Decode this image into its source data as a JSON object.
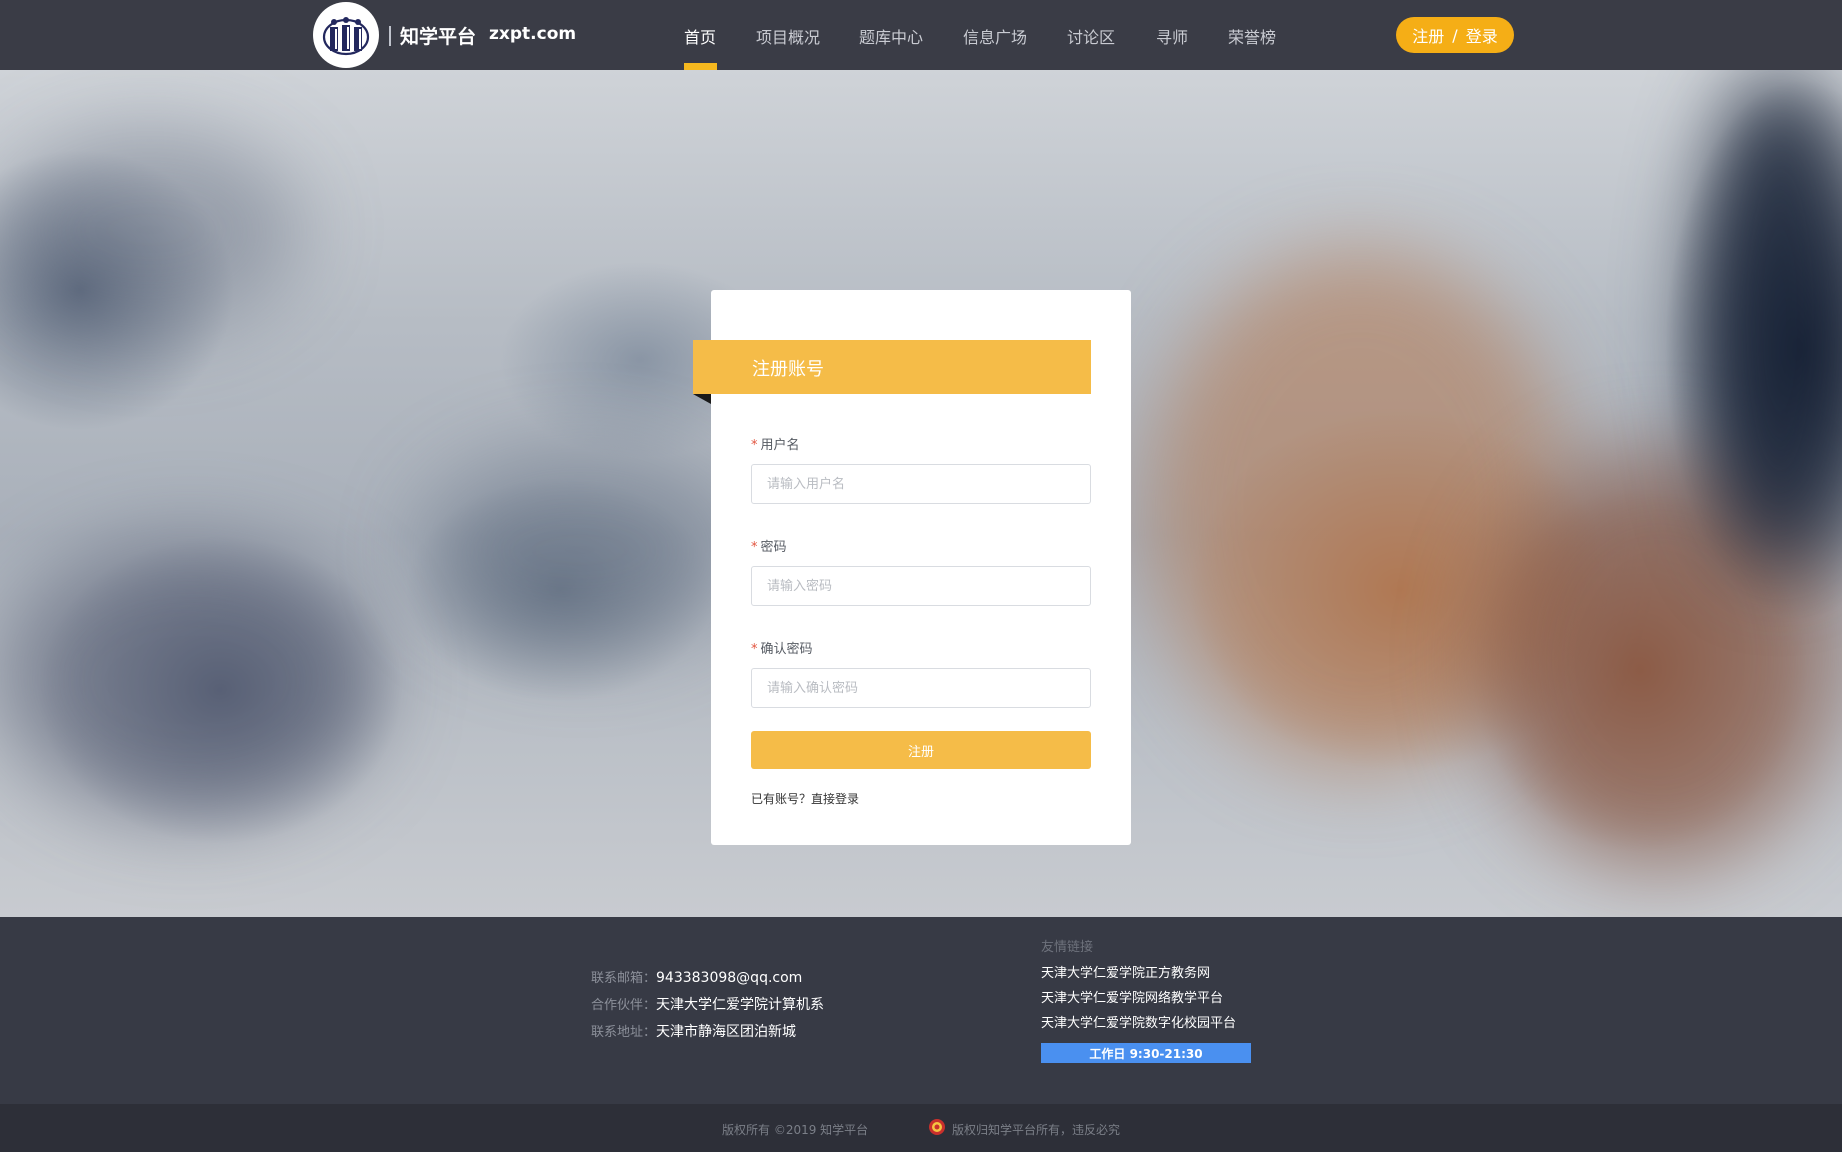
{
  "header": {
    "brand_name": "知学平台",
    "brand_domain": "zxpt.com",
    "nav": [
      {
        "label": "首页",
        "active": true
      },
      {
        "label": "项目概况",
        "active": false
      },
      {
        "label": "题库中心",
        "active": false
      },
      {
        "label": "信息广场",
        "active": false
      },
      {
        "label": "讨论区",
        "active": false
      },
      {
        "label": "寻师",
        "active": false
      },
      {
        "label": "荣誉榜",
        "active": false
      }
    ],
    "auth": {
      "register": "注册",
      "separator": "/",
      "login": "登录"
    }
  },
  "form": {
    "title": "注册账号",
    "required_mark": "*",
    "username": {
      "label": "用户名",
      "placeholder": "请输入用户名",
      "value": ""
    },
    "password": {
      "label": "密码",
      "placeholder": "请输入密码",
      "value": ""
    },
    "confirm": {
      "label": "确认密码",
      "placeholder": "请输入确认密码",
      "value": ""
    },
    "submit_label": "注册",
    "login_hint": "已有账号？",
    "login_link": "直接登录"
  },
  "footer": {
    "contact": [
      {
        "key": "联系邮箱：",
        "value": "943383098@qq.com"
      },
      {
        "key": "合作伙伴：",
        "value": "天津大学仁爱学院计算机系"
      },
      {
        "key": "联系地址：",
        "value": "天津市静海区团泊新城"
      }
    ],
    "friends_title": "友情链接",
    "friends": [
      "天津大学仁爱学院正方教务网",
      "天津大学仁爱学院网络教学平台",
      "天津大学仁爱学院数字化校园平台"
    ],
    "work_hours": "工作日 9:30-21:30",
    "copyright": "版权所有 ©2019 知学平台",
    "rights": "版权归知学平台所有，违反必究"
  },
  "colors": {
    "accent": "#f5bc48",
    "header_bg": "#3a3c46",
    "footer_bg": "#373a45",
    "link_blue": "#4a90f0"
  },
  "icons": {
    "logo": "university-logo-icon",
    "police": "police-badge-icon"
  }
}
